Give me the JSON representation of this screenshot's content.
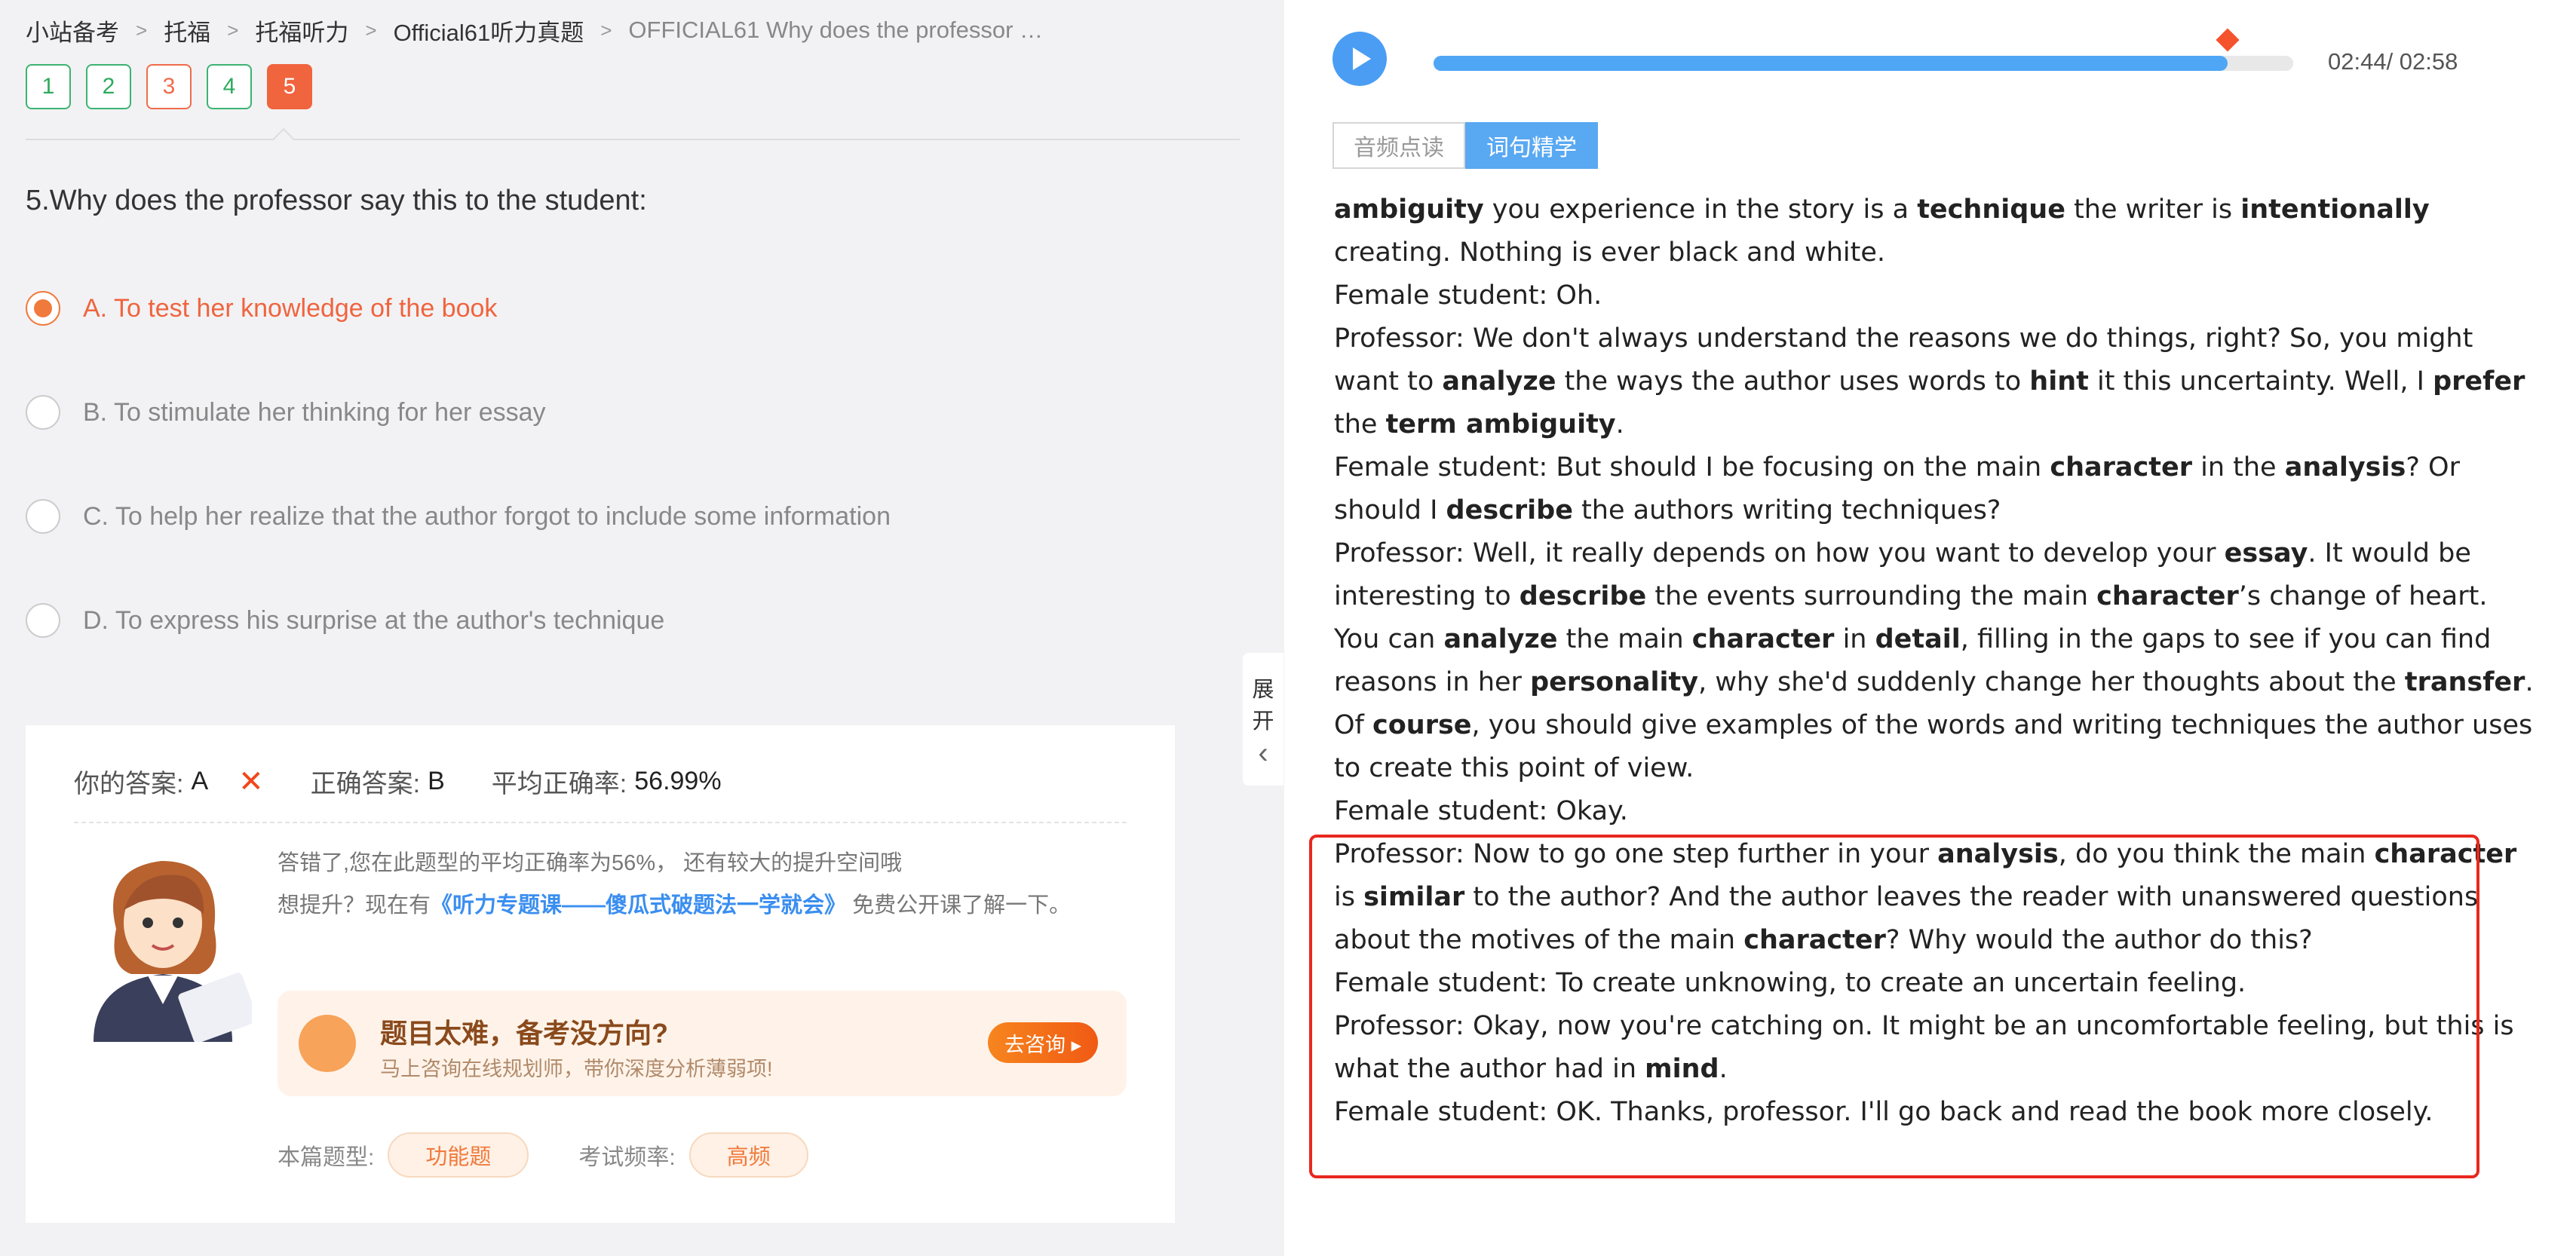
{
  "breadcrumb": [
    "小站备考",
    "托福",
    "托福听力",
    "Official61听力真题",
    "OFFICIAL61 Why does the professor …"
  ],
  "questions": [
    {
      "label": "1",
      "state": "correct"
    },
    {
      "label": "2",
      "state": "correct"
    },
    {
      "label": "3",
      "state": "wrong"
    },
    {
      "label": "4",
      "state": "correct"
    },
    {
      "label": "5",
      "state": "active"
    }
  ],
  "question_text": "5.Why does the professor say this to the student:",
  "options": [
    {
      "text": "A. To test her knowledge of the book",
      "selected": true
    },
    {
      "text": "B. To stimulate her thinking for her essay",
      "selected": false
    },
    {
      "text": "C. To help her realize that the author forgot to include some information",
      "selected": false
    },
    {
      "text": "D. To express his surprise at the author's technique",
      "selected": false
    }
  ],
  "result": {
    "your_answer_label": "你的答案:",
    "your_answer": "A",
    "correct_answer_label": "正确答案:",
    "correct_answer": "B",
    "avg_label": "平均正确率:",
    "avg_value": "56.99%"
  },
  "tip": {
    "line1": "答错了,您在此题型的平均正确率为56%， 还有较大的提升空间哦",
    "line2_prefix": "想提升？现在有",
    "link": "《听力专题课——傻瓜式破题法一学就会》",
    "line2_suffix": " 免费公开课了解一下。"
  },
  "promo": {
    "title": "题目太难，备考没方向?",
    "subtitle": "马上咨询在线规划师，带你深度分析薄弱项!",
    "button": "去咨询 ▸"
  },
  "tags": {
    "type_label": "本篇题型:",
    "type_value": "功能题",
    "freq_label": "考试频率:",
    "freq_value": "高频"
  },
  "expand": {
    "char1": "展",
    "char2": "开",
    "arrow": "‹"
  },
  "audio": {
    "time": "02:44/ 02:58",
    "progress": 0.924
  },
  "tabs": [
    "音频点读",
    "词句精学"
  ],
  "colors": {
    "accent": "#f0643e",
    "blue": "#4a9df3",
    "highlight": "#e8281e"
  }
}
